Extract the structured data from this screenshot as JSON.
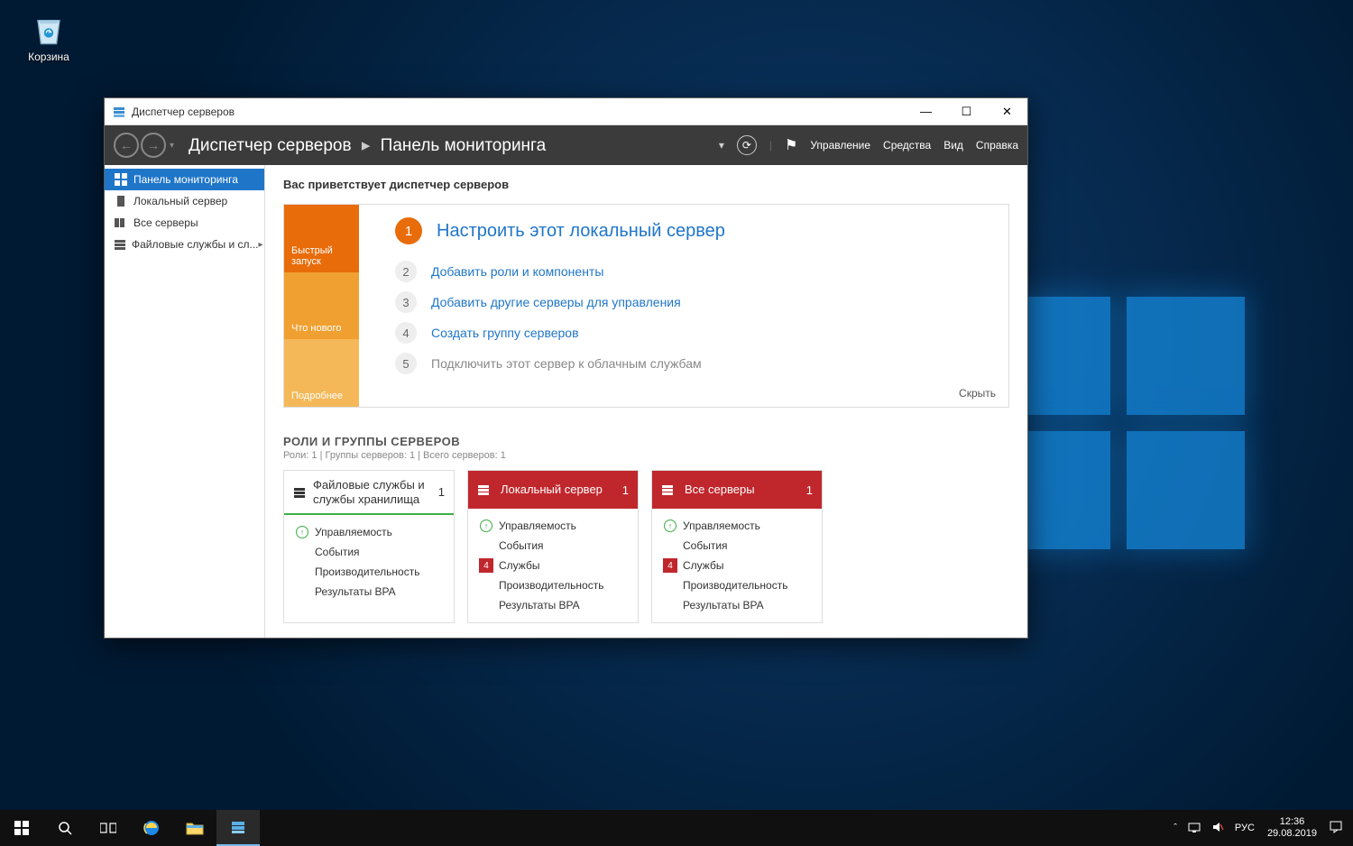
{
  "desktop": {
    "recycle_bin": "Корзина"
  },
  "window": {
    "title": "Диспетчер серверов",
    "breadcrumb": {
      "root": "Диспетчер серверов",
      "page": "Панель мониторинга"
    },
    "menu": {
      "manage": "Управление",
      "tools": "Средства",
      "view": "Вид",
      "help": "Справка"
    }
  },
  "sidebar": {
    "items": [
      {
        "label": "Панель мониторинга"
      },
      {
        "label": "Локальный сервер"
      },
      {
        "label": "Все серверы"
      },
      {
        "label": "Файловые службы и сл..."
      }
    ]
  },
  "main": {
    "welcome_title": "Вас приветствует диспетчер серверов",
    "left_tabs": {
      "quick": "Быстрый запуск",
      "whatsnew": "Что нового",
      "more": "Подробнее"
    },
    "steps": [
      {
        "n": "1",
        "label": "Настроить этот локальный сервер"
      },
      {
        "n": "2",
        "label": "Добавить роли и компоненты"
      },
      {
        "n": "3",
        "label": "Добавить другие серверы для управления"
      },
      {
        "n": "4",
        "label": "Создать группу серверов"
      },
      {
        "n": "5",
        "label": "Подключить этот сервер к облачным службам"
      }
    ],
    "hide": "Скрыть",
    "roles_title": "РОЛИ И ГРУППЫ СЕРВЕРОВ",
    "roles_sub": "Роли: 1 | Группы серверов: 1 | Всего серверов: 1",
    "tiles": [
      {
        "title": "Файловые службы и службы хранилища",
        "count": "1",
        "style": "normal",
        "rows": [
          {
            "stat": "ok",
            "label": "Управляемость"
          },
          {
            "stat": "",
            "label": "События"
          },
          {
            "stat": "",
            "label": "Производительность"
          },
          {
            "stat": "",
            "label": "Результаты BPA"
          }
        ]
      },
      {
        "title": "Локальный сервер",
        "count": "1",
        "style": "red",
        "rows": [
          {
            "stat": "ok",
            "label": "Управляемость"
          },
          {
            "stat": "",
            "label": "События"
          },
          {
            "stat": "bad",
            "badge": "4",
            "label": "Службы"
          },
          {
            "stat": "",
            "label": "Производительность"
          },
          {
            "stat": "",
            "label": "Результаты BPA"
          }
        ]
      },
      {
        "title": "Все серверы",
        "count": "1",
        "style": "red",
        "rows": [
          {
            "stat": "ok",
            "label": "Управляемость"
          },
          {
            "stat": "",
            "label": "События"
          },
          {
            "stat": "bad",
            "badge": "4",
            "label": "Службы"
          },
          {
            "stat": "",
            "label": "Производительность"
          },
          {
            "stat": "",
            "label": "Результаты BPA"
          }
        ]
      }
    ]
  },
  "taskbar": {
    "lang": "РУС",
    "time": "12:36",
    "date": "29.08.2019"
  }
}
